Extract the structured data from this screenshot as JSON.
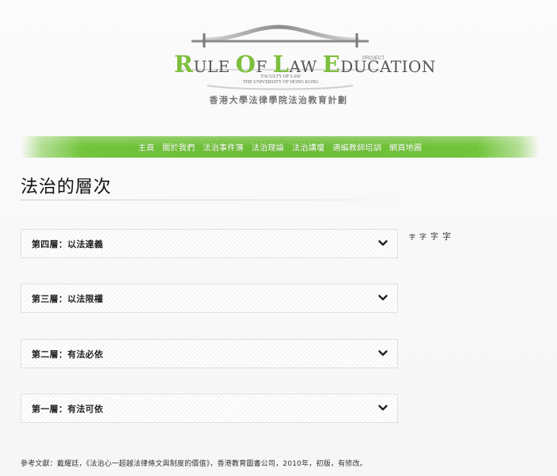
{
  "logo": {
    "letters": [
      "R",
      "ULE ",
      "O",
      "F ",
      "L",
      "AW ",
      "E",
      "DUCATION"
    ],
    "project": "PROJECT",
    "faculty": "FACULTY OF LAW",
    "university": "THE UNIVERSITY OF HONG KONG",
    "chinese": "香港大學法律學院法治教育計劃",
    "accent_color": "#7cbf3c"
  },
  "nav": {
    "items": [
      "主頁",
      "關於我們",
      "法治事件簿",
      "法治理論",
      "法治講壇",
      "適編教師培訓",
      "網頁地圖"
    ],
    "color": "#6cbd36"
  },
  "page": {
    "title": "法治的層次"
  },
  "font_sizer": {
    "labels": [
      "字",
      "字",
      "字",
      "字"
    ]
  },
  "accordion": {
    "items": [
      {
        "label": "第四層：以法達義",
        "icon": "chevron-down-icon"
      },
      {
        "label": "第三層：以法限權",
        "icon": "chevron-down-icon"
      },
      {
        "label": "第二層：有法必依",
        "icon": "chevron-down-icon"
      },
      {
        "label": "第一層：有法可依",
        "icon": "chevron-down-icon"
      }
    ]
  },
  "footer": {
    "reference": "參考文獻：戴耀廷，《法治心一超越法律條文與制度的價值》，香港教育圖書公司，2010年，初版，有修改。"
  }
}
